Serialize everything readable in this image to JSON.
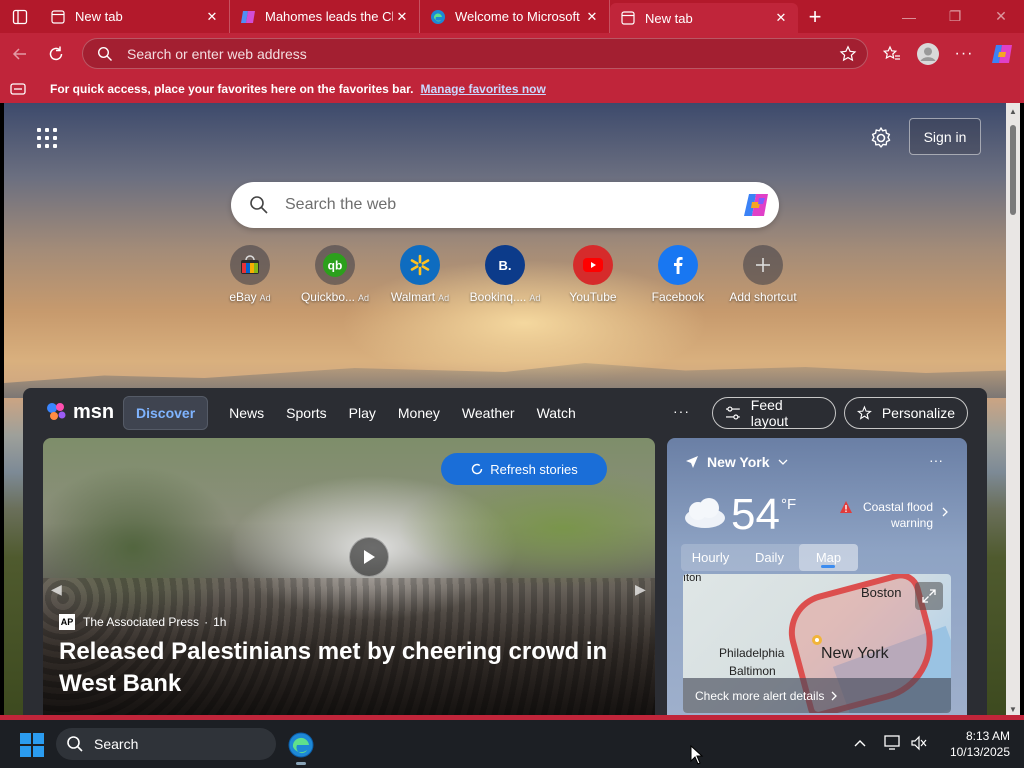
{
  "tabs": [
    {
      "label": "New tab",
      "active": false,
      "icon": "new-tab-icon"
    },
    {
      "label": "Mahomes leads the Chie",
      "active": false,
      "icon": "copilot-favicon"
    },
    {
      "label": "Welcome to Microsoft E",
      "active": false,
      "icon": "edge-favicon"
    },
    {
      "label": "New tab",
      "active": true,
      "icon": "new-tab-icon"
    }
  ],
  "address_bar": {
    "placeholder": "Search or enter web address"
  },
  "favorites_bar": {
    "message": "For quick access, place your favorites here on the favorites bar.",
    "link": "Manage favorites now"
  },
  "newtab": {
    "signin_label": "Sign in",
    "search_placeholder": "Search the web",
    "shortcuts": [
      {
        "label": "eBay",
        "ad": "Ad",
        "icon": "ebay-icon"
      },
      {
        "label": "Quickbo...",
        "ad": "Ad",
        "icon": "quickbooks-icon"
      },
      {
        "label": "Walmart",
        "ad": "Ad",
        "icon": "walmart-icon"
      },
      {
        "label": "Bookinq....",
        "ad": "Ad",
        "icon": "booking-icon"
      },
      {
        "label": "YouTube",
        "ad": "",
        "icon": "youtube-icon"
      },
      {
        "label": "Facebook",
        "ad": "",
        "icon": "facebook-icon"
      },
      {
        "label": "Add shortcut",
        "ad": "",
        "icon": "plus-icon"
      }
    ]
  },
  "feed": {
    "logo": "msn",
    "nav": [
      "Discover",
      "News",
      "Sports",
      "Play",
      "Money",
      "Weather",
      "Watch"
    ],
    "more": "···",
    "feed_layout_label": "Feed layout",
    "personalize_label": "Personalize",
    "refresh_label": "Refresh stories",
    "hero": {
      "source_logo": "AP",
      "source": "The Associated Press",
      "age": "1h",
      "headline": "Released Palestinians met by cheering crowd in West Bank"
    },
    "weather": {
      "location": "New York",
      "temp": "54",
      "unit": "°F",
      "alert": "Coastal flood warning",
      "tabs": [
        "Hourly",
        "Daily",
        "Map"
      ],
      "active_tab": "Map",
      "map_labels": {
        "boston": "Boston",
        "philadelphia": "Philadelphia",
        "baltimore": "Baltimon",
        "newyork": "New York",
        "edge": "ıton"
      },
      "alert_details": "Check more alert details"
    }
  },
  "taskbar": {
    "search_label": "Search",
    "time": "8:13 AM",
    "date": "10/13/2025"
  }
}
